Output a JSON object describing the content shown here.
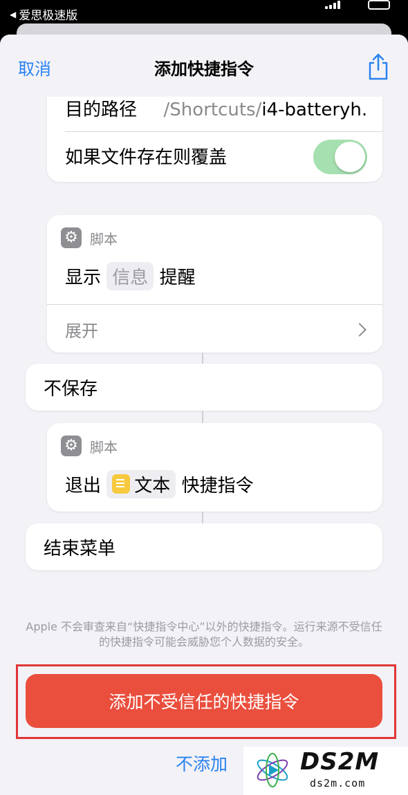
{
  "status_bar": {
    "back_app": "爱思极速版"
  },
  "nav": {
    "cancel": "取消",
    "title": "添加快捷指令",
    "share_icon": "share-icon"
  },
  "save_file_card": {
    "destination_label": "目的路径",
    "destination_prefix": "/Shortcuts/",
    "destination_file": "i4-batteryh...",
    "overwrite_label": "如果文件存在则覆盖",
    "overwrite_on": true
  },
  "alert_card": {
    "category": "脚本",
    "action_prefix": "显示",
    "action_token": "信息",
    "action_suffix": "提醒",
    "expand": "展开"
  },
  "otherwise_row": {
    "label": "不保存"
  },
  "exit_card": {
    "category": "脚本",
    "action_prefix": "退出",
    "action_token": "文本",
    "action_suffix": "快捷指令"
  },
  "end_menu_row": {
    "label": "结束菜单"
  },
  "disclaimer": "Apple 不会审查来自“快捷指令中心”以外的快捷指令。运行来源不受信任的快捷指令可能会威胁您个人数据的安全。",
  "primary_button": "添加不受信任的快捷指令",
  "secondary_button": "不添加",
  "watermark": {
    "main": "DS2M",
    "sub": "ds2m.com"
  },
  "colors": {
    "accent": "#2a82f0",
    "danger": "#ea4e3d",
    "toggle_on": "#a6e0b0",
    "highlight_border": "#e03535"
  }
}
